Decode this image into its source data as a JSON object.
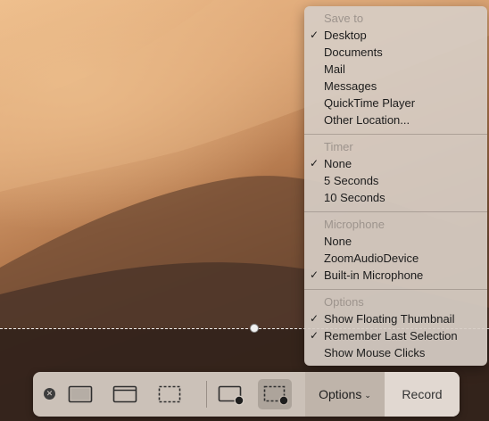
{
  "menu": {
    "sections": [
      {
        "header": "Save to",
        "items": [
          {
            "label": "Desktop",
            "checked": true
          },
          {
            "label": "Documents",
            "checked": false
          },
          {
            "label": "Mail",
            "checked": false
          },
          {
            "label": "Messages",
            "checked": false
          },
          {
            "label": "QuickTime Player",
            "checked": false
          },
          {
            "label": "Other Location...",
            "checked": false
          }
        ]
      },
      {
        "header": "Timer",
        "items": [
          {
            "label": "None",
            "checked": true
          },
          {
            "label": "5 Seconds",
            "checked": false
          },
          {
            "label": "10 Seconds",
            "checked": false
          }
        ]
      },
      {
        "header": "Microphone",
        "items": [
          {
            "label": "None",
            "checked": false
          },
          {
            "label": "ZoomAudioDevice",
            "checked": false
          },
          {
            "label": "Built-in Microphone",
            "checked": true
          }
        ]
      },
      {
        "header": "Options",
        "items": [
          {
            "label": "Show Floating Thumbnail",
            "checked": true
          },
          {
            "label": "Remember Last Selection",
            "checked": true
          },
          {
            "label": "Show Mouse Clicks",
            "checked": false
          }
        ]
      }
    ],
    "check_glyph": "✓"
  },
  "toolbar": {
    "close_glyph": "✕",
    "options_label": "Options",
    "options_chevron": "⌄",
    "record_label": "Record",
    "buttons": [
      {
        "name": "capture-entire-screen-button",
        "icon": "screen-icon",
        "selected": false
      },
      {
        "name": "capture-window-button",
        "icon": "window-icon",
        "selected": false
      },
      {
        "name": "capture-selection-button",
        "icon": "selection-icon",
        "selected": false
      },
      {
        "name": "record-entire-screen-button",
        "icon": "screen-record-icon",
        "selected": false
      },
      {
        "name": "record-selection-button",
        "icon": "selection-record-icon",
        "selected": true
      }
    ]
  }
}
